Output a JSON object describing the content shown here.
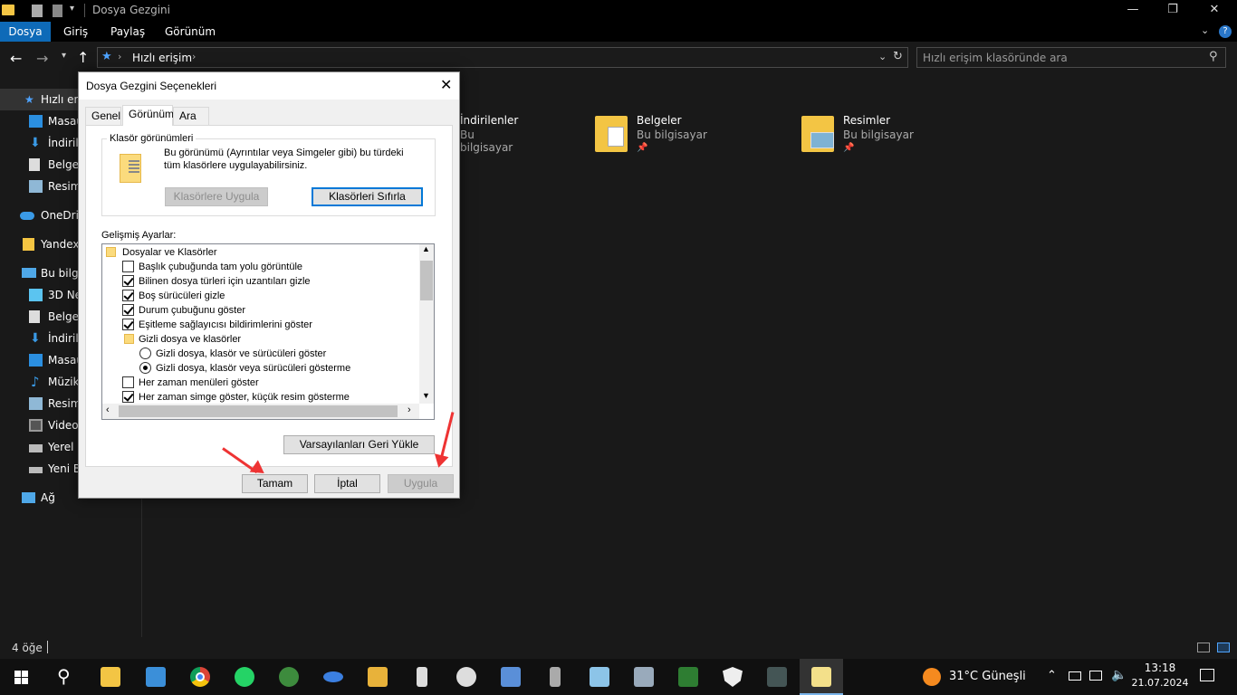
{
  "window": {
    "title": "Dosya Gezgini",
    "min": "—",
    "max": "❐",
    "close": "✕"
  },
  "ribbon": {
    "tabs": [
      "Dosya",
      "Giriş",
      "Paylaş",
      "Görünüm"
    ],
    "help": "?"
  },
  "address": {
    "path": "Hızlı erişim",
    "search_placeholder": "Hızlı erişim klasöründe ara"
  },
  "nav": {
    "items": [
      {
        "label": "Hızlı erişim"
      },
      {
        "label": "Masaüstü"
      },
      {
        "label": "İndirilenler"
      },
      {
        "label": "Belgeler"
      },
      {
        "label": "Resimler"
      },
      {
        "label": "OneDrive"
      },
      {
        "label": "Yandex.Disk"
      },
      {
        "label": "Bu bilgisayar"
      },
      {
        "label": "3D Nesneler"
      },
      {
        "label": "Belgeler"
      },
      {
        "label": "İndirilenler"
      },
      {
        "label": "Masaüstü"
      },
      {
        "label": "Müzik"
      },
      {
        "label": "Resimler"
      },
      {
        "label": "Videolar"
      },
      {
        "label": "Yerel Disk (C:)"
      },
      {
        "label": "Yeni Birim (D:)"
      },
      {
        "label": "Ağ"
      }
    ]
  },
  "content": {
    "folders": [
      {
        "name": "İndirilenler",
        "sub": "Bu bilgisayar"
      },
      {
        "name": "Belgeler",
        "sub": "Bu bilgisayar"
      },
      {
        "name": "Resimler",
        "sub": "Bu bilgisayar"
      }
    ]
  },
  "status": {
    "count": "4 öğe"
  },
  "dialog": {
    "title": "Dosya Gezgini Seçenekleri",
    "tabs": [
      "Genel",
      "Görünüm",
      "Ara"
    ],
    "group_title": "Klasör görünümleri",
    "group_text": "Bu görünümü (Ayrıntılar veya Simgeler gibi) bu türdeki tüm klasörlere uygulayabilirsiniz.",
    "apply_folders": "Klasörlere Uygula",
    "reset_folders": "Klasörleri Sıfırla",
    "advanced_label": "Gelişmiş Ayarlar:",
    "tree": {
      "root": "Dosyalar ve Klasörler",
      "items": [
        {
          "label": "Başlık çubuğunda tam yolu görüntüle",
          "checked": false
        },
        {
          "label": "Bilinen dosya türleri için uzantıları gizle",
          "checked": true
        },
        {
          "label": "Boş sürücüleri gizle",
          "checked": true
        },
        {
          "label": "Durum çubuğunu göster",
          "checked": true
        },
        {
          "label": "Eşitleme sağlayıcısı bildirimlerini göster",
          "checked": true
        }
      ],
      "hidden_group": "Gizli dosya ve klasörler",
      "radios": [
        {
          "label": "Gizli dosya, klasör ve sürücüleri göster",
          "selected": false
        },
        {
          "label": "Gizli dosya, klasör veya sürücüleri gösterme",
          "selected": true
        }
      ],
      "items2": [
        {
          "label": "Her zaman menüleri göster",
          "checked": false
        },
        {
          "label": "Her zaman simge göster, küçük resim gösterme",
          "checked": true
        }
      ]
    },
    "restore_defaults": "Varsayılanları Geri Yükle",
    "ok": "Tamam",
    "cancel": "İptal",
    "apply": "Uygula"
  },
  "taskbar": {
    "weather": "31°C  Güneşli",
    "time": "13:18",
    "date": "21.07.2024"
  },
  "colors": {
    "accent": "#0e6ab8",
    "arrow": "#e33333",
    "dialog_bg": "#f0f0f0"
  }
}
